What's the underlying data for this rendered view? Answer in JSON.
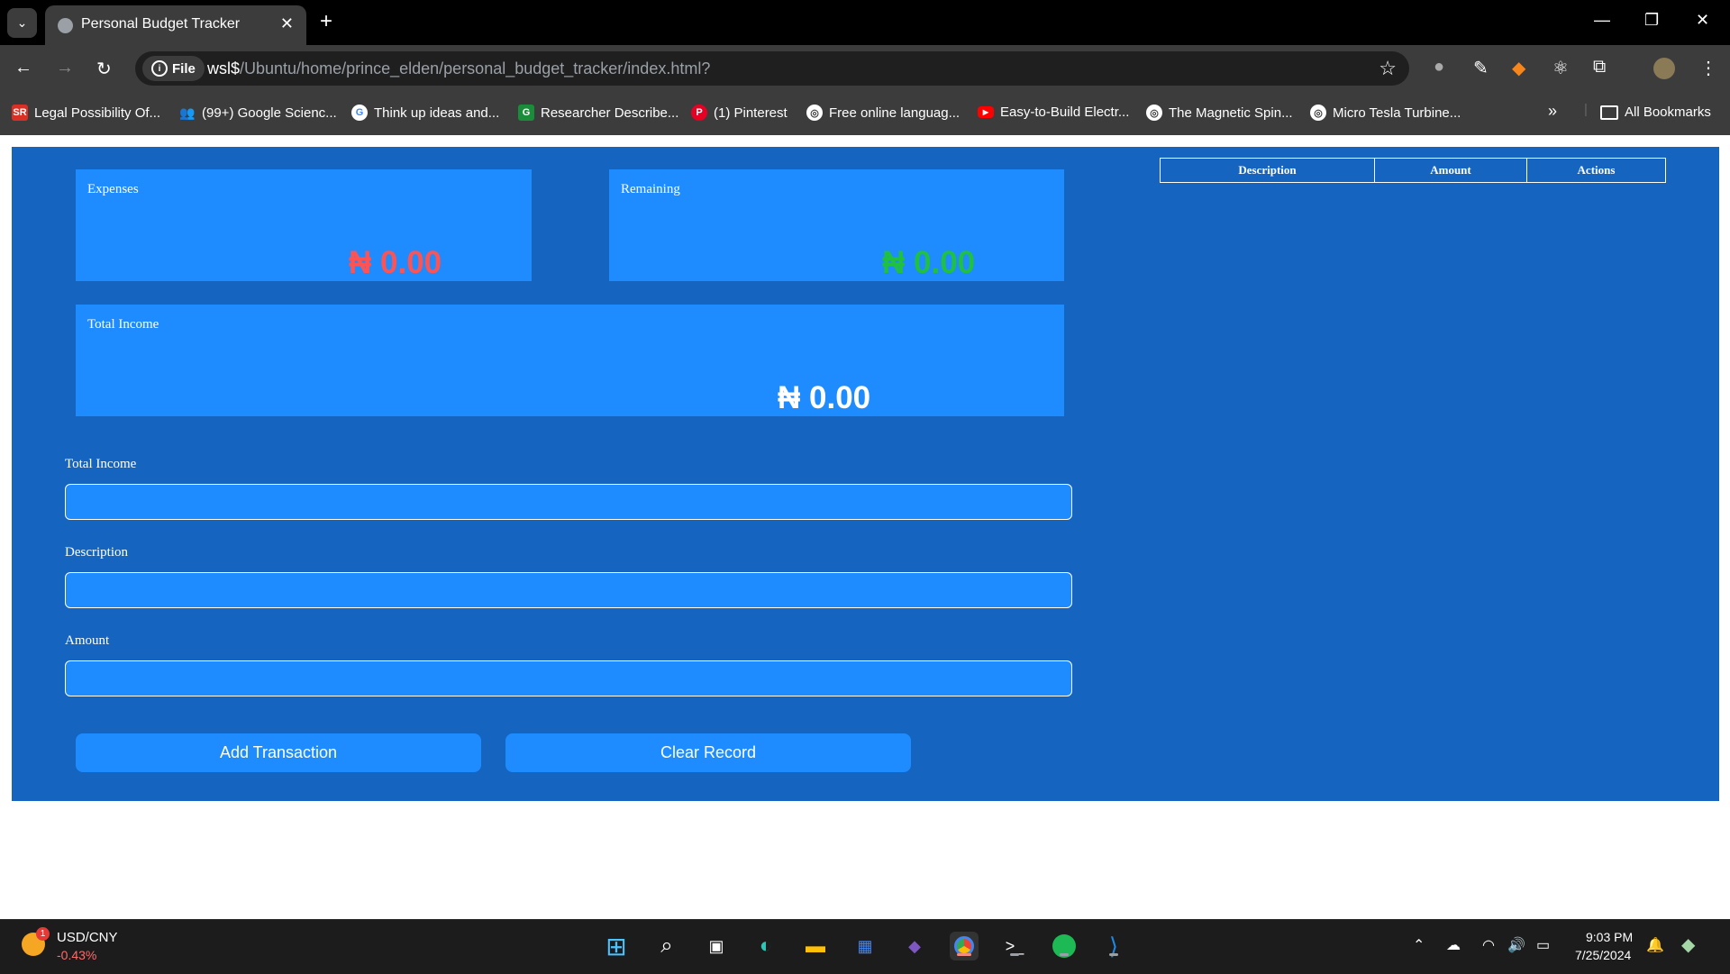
{
  "browser": {
    "tab_title": "Personal Budget Tracker",
    "file_chip": "File",
    "url_prefix": "wsl$",
    "url_rest": "/Ubuntu/home/prince_elden/personal_budget_tracker/index.html?",
    "bookmarks": [
      {
        "label": "Legal Possibility Of...",
        "icon": "sr-icon",
        "color": "#d93025"
      },
      {
        "label": "(99+) Google Scienc...",
        "icon": "people-icon",
        "color": "#4285f4"
      },
      {
        "label": "Think up ideas and...",
        "icon": "google-icon",
        "color": "#ffffff"
      },
      {
        "label": "Researcher Describe...",
        "icon": "g-icon",
        "color": "#1a8d3a"
      },
      {
        "label": "(1) Pinterest",
        "icon": "pinterest-icon",
        "color": "#e60023"
      },
      {
        "label": "Free online languag...",
        "icon": "globe-icon",
        "color": "#ffffff"
      },
      {
        "label": "Easy-to-Build Electr...",
        "icon": "youtube-icon",
        "color": "#ff0000"
      },
      {
        "label": "The Magnetic Spin...",
        "icon": "globe-icon",
        "color": "#ffffff"
      },
      {
        "label": "Micro Tesla Turbine...",
        "icon": "globe-icon",
        "color": "#ffffff"
      }
    ],
    "all_bookmarks": "All Bookmarks"
  },
  "app": {
    "expenses": {
      "label": "Expenses",
      "value": "₦ 0.00",
      "color": "#ff5252"
    },
    "remaining": {
      "label": "Remaining",
      "value": "₦ 0.00",
      "color": "#20c040"
    },
    "total_income_card": {
      "label": "Total Income",
      "value": "₦ 0.00",
      "color": "#ffffff"
    },
    "form": {
      "income_label": "Total Income",
      "description_label": "Description",
      "amount_label": "Amount"
    },
    "buttons": {
      "add": "Add Transaction",
      "clear": "Clear Record"
    },
    "table": {
      "headers": [
        "Description",
        "Amount",
        "Actions"
      ]
    }
  },
  "taskbar": {
    "widget_title": "USD/CNY",
    "widget_change": "-0.43%",
    "widget_badge": "1",
    "time": "9:03 PM",
    "date": "7/25/2024"
  }
}
